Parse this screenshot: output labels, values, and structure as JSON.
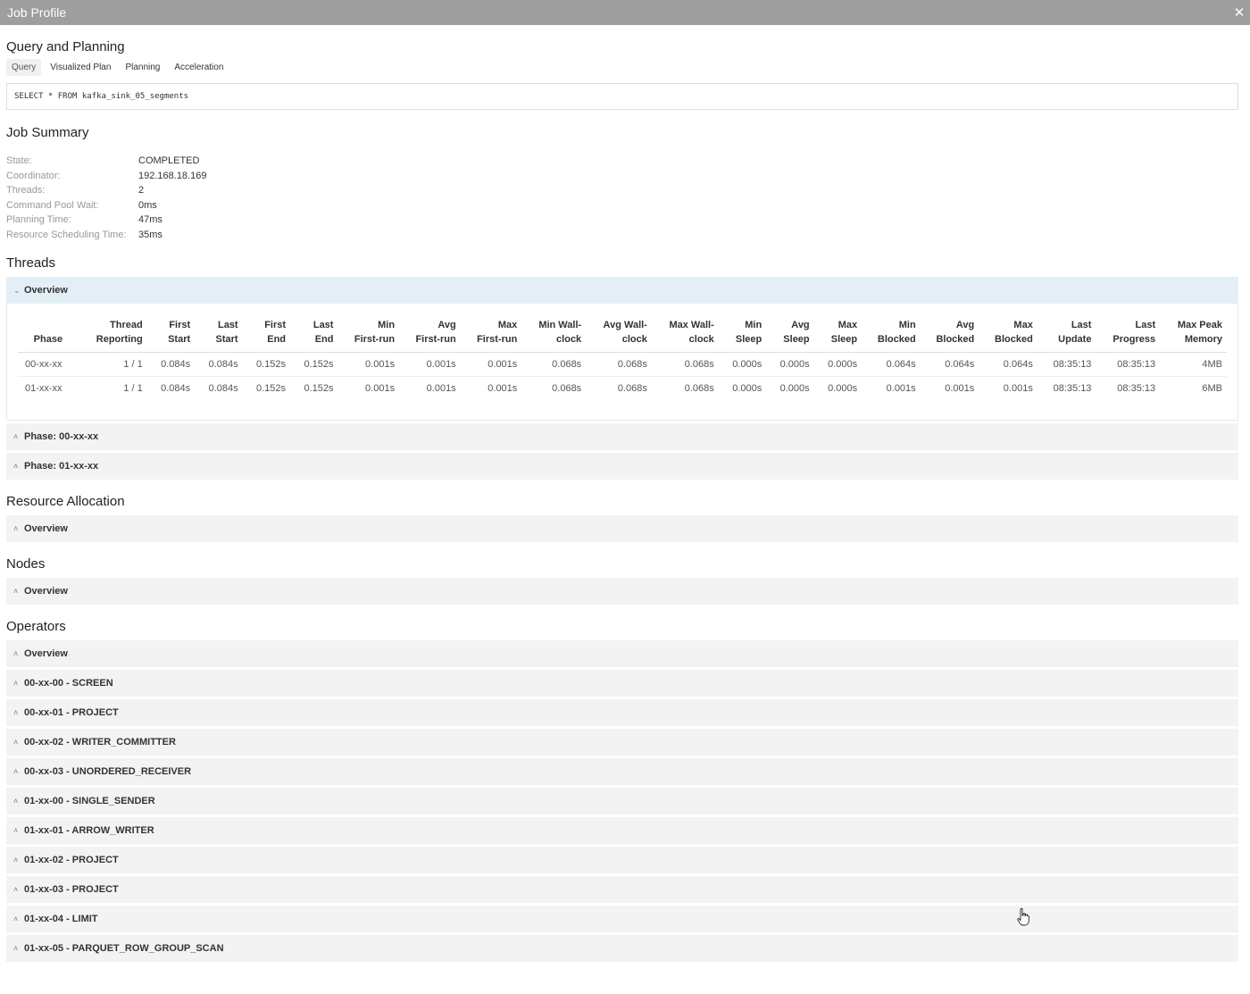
{
  "window": {
    "title": "Job Profile"
  },
  "query_planning": {
    "title": "Query and Planning",
    "tabs": [
      "Query",
      "Visualized Plan",
      "Planning",
      "Acceleration"
    ],
    "query_text": "SELECT * FROM kafka_sink_05_segments"
  },
  "job_summary": {
    "title": "Job Summary",
    "rows": [
      {
        "label": "State:",
        "value": "COMPLETED"
      },
      {
        "label": "Coordinator:",
        "value": "192.168.18.169"
      },
      {
        "label": "Threads:",
        "value": "2"
      },
      {
        "label": "Command Pool Wait:",
        "value": "0ms"
      },
      {
        "label": "Planning Time:",
        "value": "47ms"
      },
      {
        "label": "Resource Scheduling Time:",
        "value": "35ms"
      }
    ]
  },
  "threads": {
    "title": "Threads",
    "overview_label": "Overview",
    "headers": [
      [
        "Phase"
      ],
      [
        "Thread",
        "Reporting"
      ],
      [
        "First",
        "Start"
      ],
      [
        "Last",
        "Start"
      ],
      [
        "First",
        "End"
      ],
      [
        "Last",
        "End"
      ],
      [
        "Min",
        "First-run"
      ],
      [
        "Avg",
        "First-run"
      ],
      [
        "Max",
        "First-run"
      ],
      [
        "Min Wall-",
        "clock"
      ],
      [
        "Avg Wall-",
        "clock"
      ],
      [
        "Max Wall-",
        "clock"
      ],
      [
        "Min",
        "Sleep"
      ],
      [
        "Avg",
        "Sleep"
      ],
      [
        "Max",
        "Sleep"
      ],
      [
        "Min",
        "Blocked"
      ],
      [
        "Avg",
        "Blocked"
      ],
      [
        "Max",
        "Blocked"
      ],
      [
        "Last",
        "Update"
      ],
      [
        "Last",
        "Progress"
      ],
      [
        "Max Peak",
        "Memory"
      ]
    ],
    "rows": [
      [
        "00-xx-xx",
        "1 / 1",
        "0.084s",
        "0.084s",
        "0.152s",
        "0.152s",
        "0.001s",
        "0.001s",
        "0.001s",
        "0.068s",
        "0.068s",
        "0.068s",
        "0.000s",
        "0.000s",
        "0.000s",
        "0.064s",
        "0.064s",
        "0.064s",
        "08:35:13",
        "08:35:13",
        "4MB"
      ],
      [
        "01-xx-xx",
        "1 / 1",
        "0.084s",
        "0.084s",
        "0.152s",
        "0.152s",
        "0.001s",
        "0.001s",
        "0.001s",
        "0.068s",
        "0.068s",
        "0.068s",
        "0.000s",
        "0.000s",
        "0.000s",
        "0.001s",
        "0.001s",
        "0.001s",
        "08:35:13",
        "08:35:13",
        "6MB"
      ]
    ],
    "phases": [
      "Phase: 00-xx-xx",
      "Phase: 01-xx-xx"
    ]
  },
  "resource_allocation": {
    "title": "Resource Allocation",
    "items": [
      "Overview"
    ]
  },
  "nodes": {
    "title": "Nodes",
    "items": [
      "Overview"
    ]
  },
  "operators": {
    "title": "Operators",
    "items": [
      "Overview",
      "00-xx-00 - SCREEN",
      "00-xx-01 - PROJECT",
      "00-xx-02 - WRITER_COMMITTER",
      "00-xx-03 - UNORDERED_RECEIVER",
      "01-xx-00 - SINGLE_SENDER",
      "01-xx-01 - ARROW_WRITER",
      "01-xx-02 - PROJECT",
      "01-xx-03 - PROJECT",
      "01-xx-04 - LIMIT",
      "01-xx-05 - PARQUET_ROW_GROUP_SCAN"
    ]
  },
  "icons": {
    "close": "close-icon",
    "expanded": "chevron-down-icon",
    "collapsed": "chevron-up-icon",
    "cursor": "hand-pointer-icon"
  }
}
